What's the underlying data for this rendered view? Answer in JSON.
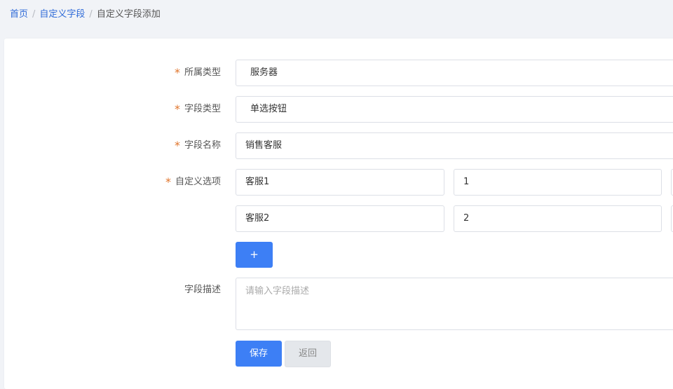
{
  "breadcrumb": {
    "items": [
      "首页",
      "自定义字段"
    ],
    "current": "自定义字段添加",
    "separator": "/"
  },
  "form": {
    "required_mark": "*",
    "belong_type": {
      "label": "所属类型",
      "value": "服务器"
    },
    "field_type": {
      "label": "字段类型",
      "value": "单选按钮"
    },
    "field_name": {
      "label": "字段名称",
      "value": "销售客服"
    },
    "custom_options": {
      "label": "自定义选项",
      "rows": [
        {
          "name": "客服1",
          "value": "1"
        },
        {
          "name": "客服2",
          "value": "2"
        }
      ],
      "add_label": "+"
    },
    "description": {
      "label": "字段描述",
      "placeholder": "请输入字段描述"
    }
  },
  "actions": {
    "save_label": "保存",
    "back_label": "返回"
  },
  "colors": {
    "primary": "#3d7ff5",
    "link": "#2f6bd8",
    "required": "#e0752b",
    "background": "#f1f3f7"
  }
}
